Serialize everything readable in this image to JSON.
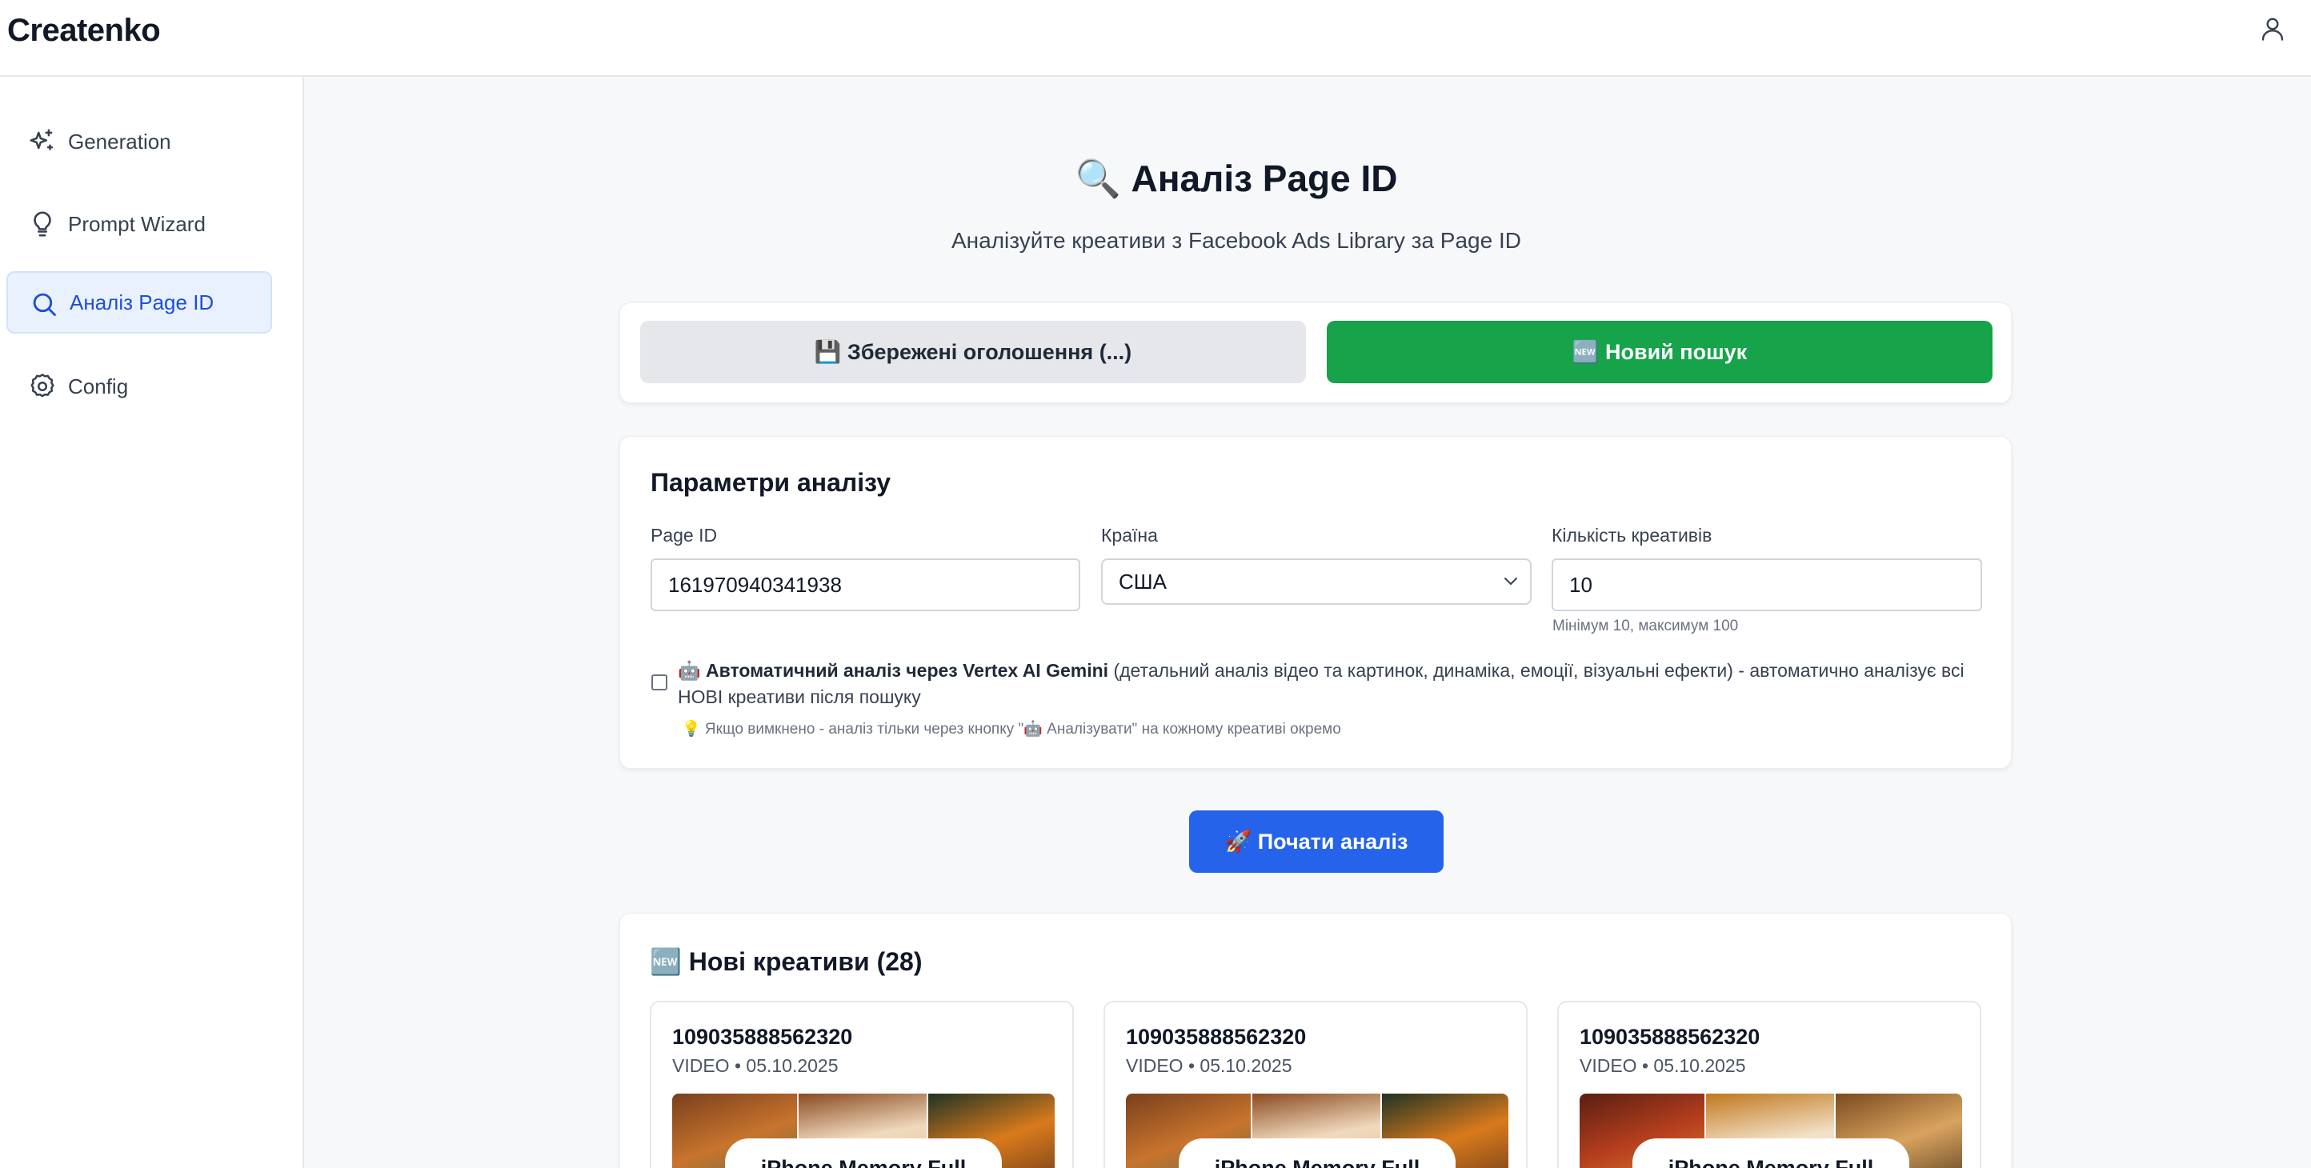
{
  "header": {
    "logo": "Createnko",
    "user_icon": "user-icon"
  },
  "sidebar": {
    "items": [
      {
        "label": "Generation",
        "icon": "sparkles-icon",
        "active": false
      },
      {
        "label": "Prompt Wizard",
        "icon": "lightbulb-icon",
        "active": false
      },
      {
        "label": "Аналіз Page ID",
        "icon": "search-icon",
        "active": true
      },
      {
        "label": "Config",
        "icon": "gear-icon",
        "active": false
      }
    ]
  },
  "main": {
    "title": "🔍 Аналіз Page ID",
    "subtitle": "Аналізуйте креативи з Facebook Ads Library за Page ID",
    "tabs": {
      "saved_label": "💾 Збережені оголошення (...)",
      "new_label": "🆕 Новий пошук"
    },
    "params": {
      "title": "Параметри аналізу",
      "page_id_label": "Page ID",
      "page_id_value": "161970940341938",
      "country_label": "Країна",
      "country_value": "США",
      "count_label": "Кількість креативів",
      "count_value": "10",
      "count_hint": "Мінімум 10, максимум 100",
      "auto_bold": "🤖 Автоматичний аналіз через Vertex AI Gemini",
      "auto_rest": " (детальний аналіз відео та картинок, динаміка, емоції, візуальні ефекти) - автоматично аналізує всі НОВІ креативи після пошуку",
      "auto_checked": false,
      "auto_hint": "💡 Якщо вимкнено - аналіз тільки через кнопку \"🤖 Аналізувати\" на кожному креативі окремо"
    },
    "start_label": "🚀 Почати аналіз",
    "new_creatives_title": "🆕 Нові креативи (28)",
    "creatives": [
      {
        "id": "109035888562320",
        "meta": "VIDEO • 05.10.2025",
        "overlay": "iPhone Memory Full"
      },
      {
        "id": "109035888562320",
        "meta": "VIDEO • 05.10.2025",
        "overlay": "iPhone Memory Full"
      },
      {
        "id": "109035888562320",
        "meta": "VIDEO • 05.10.2025",
        "overlay": "iPhone Memory Full"
      }
    ]
  },
  "colors": {
    "primary_blue": "#2563eb",
    "success_green": "#16a34a",
    "active_nav_bg": "#e8f1fd"
  }
}
